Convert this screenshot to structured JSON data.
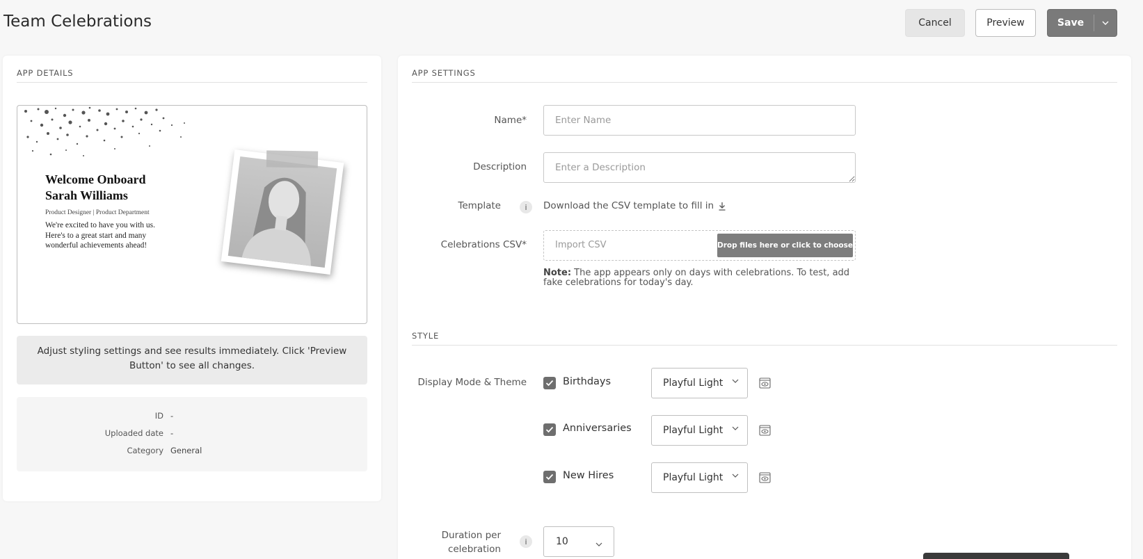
{
  "header": {
    "title": "Team Celebrations",
    "cancel_label": "Cancel",
    "preview_label": "Preview",
    "save_label": "Save"
  },
  "app_details": {
    "section_title": "APP DETAILS",
    "preview_card": {
      "welcome_line1": "Welcome Onboard",
      "welcome_line2": "Sarah Williams",
      "role": "Product Designer | Product Department",
      "message": "We're excited to have you with us. Here's to a great start and many wonderful achievements ahead!"
    },
    "info_text": "Adjust styling settings and see results immediately. Click 'Preview Button' to see all changes.",
    "meta": [
      {
        "key": "ID",
        "value": "-"
      },
      {
        "key": "Uploaded date",
        "value": "-"
      },
      {
        "key": "Category",
        "value": "General"
      }
    ]
  },
  "app_settings": {
    "section_title": "APP SETTINGS",
    "name": {
      "label": "Name*",
      "placeholder": "Enter Name",
      "value": ""
    },
    "description": {
      "label": "Description",
      "placeholder": "Enter a Description",
      "value": ""
    },
    "template": {
      "label": "Template",
      "info_icon": "i",
      "link_text": "Download the CSV template to fill in"
    },
    "csv": {
      "label": "Celebrations CSV*",
      "placeholder": "Import CSV",
      "button_label": "Drop files here or click to choose"
    },
    "note_bold": "Note:",
    "note_text": " The app appears only on days with celebrations. To test, add fake celebrations for today's day."
  },
  "style": {
    "section_title": "STYLE",
    "display_label": "Display Mode & Theme",
    "options": [
      {
        "label": "Birthdays",
        "checked": true,
        "theme": "Playful Light"
      },
      {
        "label": "Anniversaries",
        "checked": true,
        "theme": "Playful Light"
      },
      {
        "label": "New Hires",
        "checked": true,
        "theme": "Playful Light"
      }
    ],
    "duration_label_line1": "Duration per",
    "duration_label_line2": "celebration",
    "duration_value": "10"
  },
  "colors": {
    "save_bg": "#7a7a7a",
    "checkbox": "#6e6e6e",
    "csv_button": "#7d7d7d"
  }
}
